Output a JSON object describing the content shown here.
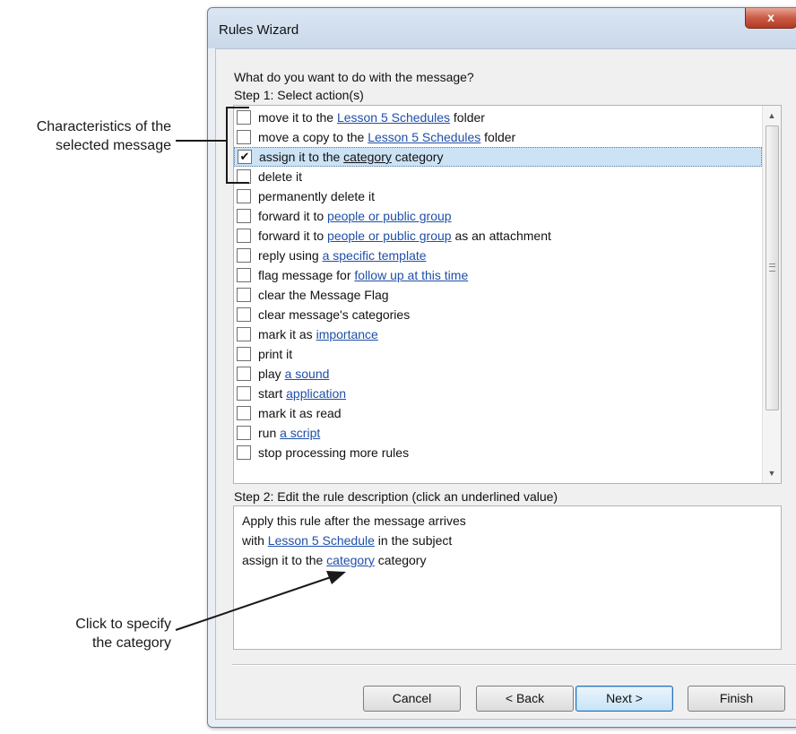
{
  "callouts": {
    "characteristics_line1": "Characteristics of the",
    "characteristics_line2": "selected message",
    "click_line1": "Click to specify",
    "click_line2": "the category"
  },
  "window": {
    "title": "Rules Wizard",
    "close_glyph": "x"
  },
  "prompt": {
    "question": "What do you want to do with the message?",
    "step1": "Step 1: Select action(s)",
    "step2": "Step 2: Edit the rule description (click an underlined value)"
  },
  "actions": [
    {
      "checked": false,
      "pre": "move it to the ",
      "link": "Lesson 5 Schedules",
      "post": " folder"
    },
    {
      "checked": false,
      "pre": "move a copy to the ",
      "link": "Lesson 5 Schedules",
      "post": " folder"
    },
    {
      "checked": true,
      "pre": "assign it to the ",
      "link": "category",
      "post": " category"
    },
    {
      "checked": false,
      "pre": "delete it",
      "link": "",
      "post": ""
    },
    {
      "checked": false,
      "pre": "permanently delete it",
      "link": "",
      "post": ""
    },
    {
      "checked": false,
      "pre": "forward it to ",
      "link": "people or public group",
      "post": ""
    },
    {
      "checked": false,
      "pre": "forward it to ",
      "link": "people or public group",
      "post": " as an attachment"
    },
    {
      "checked": false,
      "pre": "reply using ",
      "link": "a specific template",
      "post": ""
    },
    {
      "checked": false,
      "pre": "flag message for ",
      "link": "follow up at this time",
      "post": ""
    },
    {
      "checked": false,
      "pre": "clear the Message Flag",
      "link": "",
      "post": ""
    },
    {
      "checked": false,
      "pre": "clear message's categories",
      "link": "",
      "post": ""
    },
    {
      "checked": false,
      "pre": "mark it as ",
      "link": "importance",
      "post": ""
    },
    {
      "checked": false,
      "pre": "print it",
      "link": "",
      "post": ""
    },
    {
      "checked": false,
      "pre": "play ",
      "link": "a sound",
      "post": ""
    },
    {
      "checked": false,
      "pre": "start ",
      "link": "application",
      "post": ""
    },
    {
      "checked": false,
      "pre": "mark it as read",
      "link": "",
      "post": ""
    },
    {
      "checked": false,
      "pre": "run ",
      "link": "a script",
      "post": ""
    },
    {
      "checked": false,
      "pre": "stop processing more rules",
      "link": "",
      "post": ""
    }
  ],
  "description": {
    "line1": "Apply this rule after the message arrives",
    "line2_pre": "with ",
    "line2_link": "Lesson 5 Schedule",
    "line2_post": " in the subject",
    "line3_pre": "assign it to the ",
    "line3_link": "category",
    "line3_post": " category"
  },
  "buttons": {
    "cancel": "Cancel",
    "back": "< Back",
    "next": "Next >",
    "finish": "Finish"
  },
  "colors": {
    "link": "#1f4fa8",
    "selection": "#cce2f5",
    "close_button": "#c95b45"
  }
}
